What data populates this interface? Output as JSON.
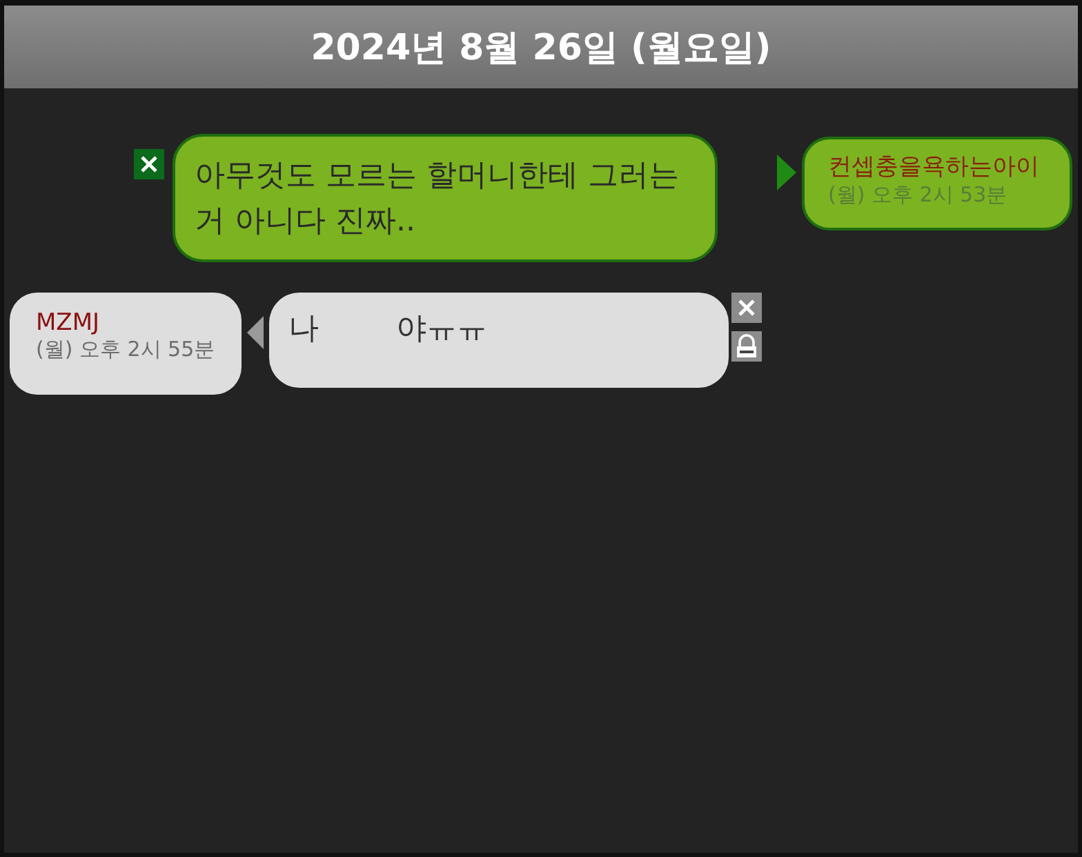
{
  "header": {
    "date": "2024년 8월 26일 (월요일)"
  },
  "messages": [
    {
      "kind": "outgoing",
      "text": "아무것도 모르는 할머니한테 그러는거 아니다 진짜..",
      "sender": "컨셉충을욕하는아이",
      "time": "(월) 오후 2시 53분"
    },
    {
      "kind": "incoming",
      "text": "나        야ㅠㅠ",
      "sender": "MZMJ",
      "time": "(월) 오후 2시 55분"
    }
  ]
}
